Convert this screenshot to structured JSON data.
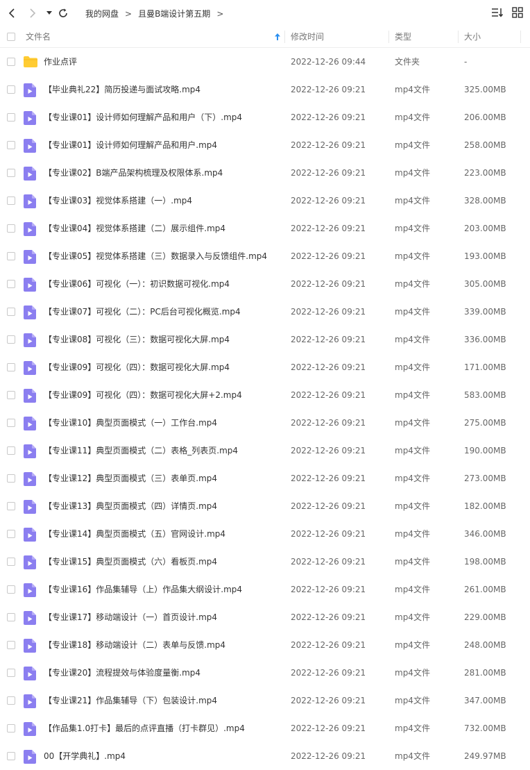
{
  "nav": {
    "breadcrumbs": [
      "我的网盘",
      "且曼B端设计第五期"
    ],
    "separator": ">"
  },
  "columns": {
    "name": "文件名",
    "modified": "修改时间",
    "type": "类型",
    "size": "大小"
  },
  "colors": {
    "accent": "#2b8ff0",
    "folder": "#ffcc33",
    "video": "#8b7ef0"
  },
  "files": [
    {
      "icon": "folder-icon",
      "name": "作业点评",
      "modified": "2022-12-26 09:44",
      "type": "文件夹",
      "size": "-"
    },
    {
      "icon": "video-file-icon",
      "name": "【毕业典礼22】简历投递与面试攻略.mp4",
      "modified": "2022-12-26 09:21",
      "type": "mp4文件",
      "size": "325.00MB"
    },
    {
      "icon": "video-file-icon",
      "name": "【专业课01】设计师如何理解产品和用户（下）.mp4",
      "modified": "2022-12-26 09:21",
      "type": "mp4文件",
      "size": "206.00MB"
    },
    {
      "icon": "video-file-icon",
      "name": "【专业课01】设计师如何理解产品和用户.mp4",
      "modified": "2022-12-26 09:21",
      "type": "mp4文件",
      "size": "258.00MB"
    },
    {
      "icon": "video-file-icon",
      "name": "【专业课02】B端产品架构梳理及权限体系.mp4",
      "modified": "2022-12-26 09:21",
      "type": "mp4文件",
      "size": "223.00MB"
    },
    {
      "icon": "video-file-icon",
      "name": "【专业课03】视觉体系搭建（一）.mp4",
      "modified": "2022-12-26 09:21",
      "type": "mp4文件",
      "size": "328.00MB"
    },
    {
      "icon": "video-file-icon",
      "name": "【专业课04】视觉体系搭建（二）展示组件.mp4",
      "modified": "2022-12-26 09:21",
      "type": "mp4文件",
      "size": "203.00MB"
    },
    {
      "icon": "video-file-icon",
      "name": "【专业课05】视觉体系搭建（三）数据录入与反馈组件.mp4",
      "modified": "2022-12-26 09:21",
      "type": "mp4文件",
      "size": "193.00MB"
    },
    {
      "icon": "video-file-icon",
      "name": "【专业课06】可视化（一）：初识数据可视化.mp4",
      "modified": "2022-12-26 09:21",
      "type": "mp4文件",
      "size": "305.00MB"
    },
    {
      "icon": "video-file-icon",
      "name": "【专业课07】可视化（二）：PC后台可视化概览.mp4",
      "modified": "2022-12-26 09:21",
      "type": "mp4文件",
      "size": "339.00MB"
    },
    {
      "icon": "video-file-icon",
      "name": "【专业课08】可视化（三）：数据可视化大屏.mp4",
      "modified": "2022-12-26 09:21",
      "type": "mp4文件",
      "size": "336.00MB"
    },
    {
      "icon": "video-file-icon",
      "name": "【专业课09】可视化（四）：数据可视化大屏.mp4",
      "modified": "2022-12-26 09:21",
      "type": "mp4文件",
      "size": "171.00MB"
    },
    {
      "icon": "video-file-icon",
      "name": "【专业课09】可视化（四）：数据可视化大屏+2.mp4",
      "modified": "2022-12-26 09:21",
      "type": "mp4文件",
      "size": "583.00MB"
    },
    {
      "icon": "video-file-icon",
      "name": "【专业课10】典型页面模式（一）工作台.mp4",
      "modified": "2022-12-26 09:21",
      "type": "mp4文件",
      "size": "275.00MB"
    },
    {
      "icon": "video-file-icon",
      "name": "【专业课11】典型页面模式（二）表格_列表页.mp4",
      "modified": "2022-12-26 09:21",
      "type": "mp4文件",
      "size": "190.00MB"
    },
    {
      "icon": "video-file-icon",
      "name": "【专业课12】典型页面模式（三）表单页.mp4",
      "modified": "2022-12-26 09:21",
      "type": "mp4文件",
      "size": "273.00MB"
    },
    {
      "icon": "video-file-icon",
      "name": "【专业课13】典型页面模式（四）详情页.mp4",
      "modified": "2022-12-26 09:21",
      "type": "mp4文件",
      "size": "182.00MB"
    },
    {
      "icon": "video-file-icon",
      "name": "【专业课14】典型页面模式（五）官网设计.mp4",
      "modified": "2022-12-26 09:21",
      "type": "mp4文件",
      "size": "346.00MB"
    },
    {
      "icon": "video-file-icon",
      "name": "【专业课15】典型页面模式（六）看板页.mp4",
      "modified": "2022-12-26 09:21",
      "type": "mp4文件",
      "size": "198.00MB"
    },
    {
      "icon": "video-file-icon",
      "name": "【专业课16】作品集辅导（上）作品集大纲设计.mp4",
      "modified": "2022-12-26 09:21",
      "type": "mp4文件",
      "size": "261.00MB"
    },
    {
      "icon": "video-file-icon",
      "name": "【专业课17】移动端设计（一）首页设计.mp4",
      "modified": "2022-12-26 09:21",
      "type": "mp4文件",
      "size": "229.00MB"
    },
    {
      "icon": "video-file-icon",
      "name": "【专业课18】移动端设计（二）表单与反馈.mp4",
      "modified": "2022-12-26 09:21",
      "type": "mp4文件",
      "size": "248.00MB"
    },
    {
      "icon": "video-file-icon",
      "name": "【专业课20】流程提效与体验度量衡.mp4",
      "modified": "2022-12-26 09:21",
      "type": "mp4文件",
      "size": "281.00MB"
    },
    {
      "icon": "video-file-icon",
      "name": "【专业课21】作品集辅导（下）包装设计.mp4",
      "modified": "2022-12-26 09:21",
      "type": "mp4文件",
      "size": "347.00MB"
    },
    {
      "icon": "video-file-icon",
      "name": "【作品集1.0打卡】最后的点评直播（打卡群见）.mp4",
      "modified": "2022-12-26 09:21",
      "type": "mp4文件",
      "size": "732.00MB"
    },
    {
      "icon": "video-file-icon",
      "name": "00【开学典礼】.mp4",
      "modified": "2022-12-26 09:21",
      "type": "mp4文件",
      "size": "249.97MB"
    }
  ]
}
